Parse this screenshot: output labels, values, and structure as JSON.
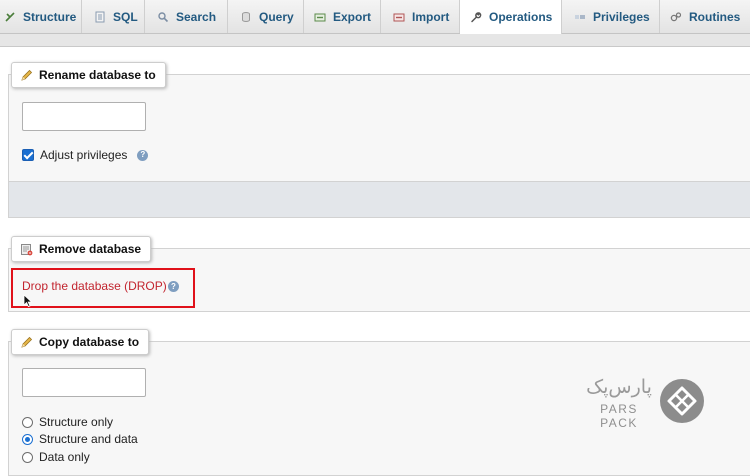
{
  "tabs": [
    {
      "label": "Structure",
      "icon": "structure-icon",
      "active": false
    },
    {
      "label": "SQL",
      "icon": "sql-icon",
      "active": false
    },
    {
      "label": "Search",
      "icon": "search-icon",
      "active": false
    },
    {
      "label": "Query",
      "icon": "query-icon",
      "active": false
    },
    {
      "label": "Export",
      "icon": "export-icon",
      "active": false
    },
    {
      "label": "Import",
      "icon": "import-icon",
      "active": false
    },
    {
      "label": "Operations",
      "icon": "wrench-icon",
      "active": true
    },
    {
      "label": "Privileges",
      "icon": "privileges-icon",
      "active": false
    },
    {
      "label": "Routines",
      "icon": "routines-icon",
      "active": false
    }
  ],
  "rename": {
    "legend": "Rename database to",
    "input_value": "",
    "adjust_privileges_label": "Adjust privileges",
    "adjust_privileges_checked": true
  },
  "remove": {
    "legend": "Remove database",
    "drop_link": "Drop the database (DROP)"
  },
  "copy": {
    "legend": "Copy database to",
    "input_value": "",
    "options": [
      {
        "label": "Structure only",
        "selected": false
      },
      {
        "label": "Structure and data",
        "selected": true
      },
      {
        "label": "Data only",
        "selected": false
      }
    ]
  },
  "watermark": {
    "text_fa": "پارس‌پک",
    "text_en": "PARS PACK"
  },
  "colors": {
    "link_blue": "#235a81",
    "drop_red": "#c2252f",
    "highlight_red": "#e0111a",
    "checkbox_blue": "#1a6fd1"
  }
}
